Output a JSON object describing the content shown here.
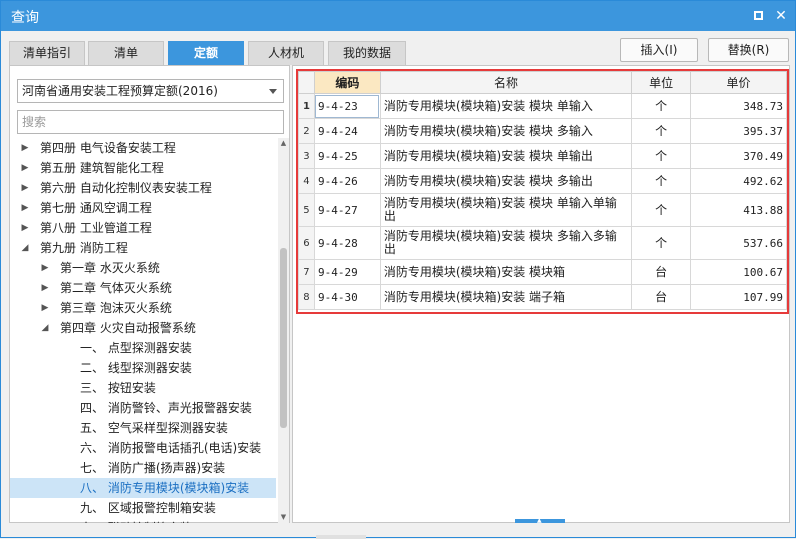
{
  "window": {
    "title": "查询"
  },
  "tabs": [
    {
      "label": "清单指引",
      "active": false
    },
    {
      "label": "清单",
      "active": false
    },
    {
      "label": "定额",
      "active": true
    },
    {
      "label": "人材机",
      "active": false
    },
    {
      "label": "我的数据",
      "active": false
    }
  ],
  "actions": {
    "insert_label": "插入(I)",
    "replace_label": "替换(R)"
  },
  "left": {
    "library_select": "河南省通用安装工程预算定额(2016)",
    "search_placeholder": "搜索",
    "tree": [
      {
        "label": "第四册 电气设备安装工程",
        "level": 0,
        "expand": "collapsed"
      },
      {
        "label": "第五册 建筑智能化工程",
        "level": 0,
        "expand": "collapsed"
      },
      {
        "label": "第六册 自动化控制仪表安装工程",
        "level": 0,
        "expand": "collapsed"
      },
      {
        "label": "第七册 通风空调工程",
        "level": 0,
        "expand": "collapsed"
      },
      {
        "label": "第八册 工业管道工程",
        "level": 0,
        "expand": "collapsed"
      },
      {
        "label": "第九册 消防工程",
        "level": 0,
        "expand": "expanded"
      },
      {
        "label": "第一章 水灭火系统",
        "level": 1,
        "expand": "collapsed"
      },
      {
        "label": "第二章 气体灭火系统",
        "level": 1,
        "expand": "collapsed"
      },
      {
        "label": "第三章 泡沫灭火系统",
        "level": 1,
        "expand": "collapsed"
      },
      {
        "label": "第四章 火灾自动报警系统",
        "level": 1,
        "expand": "expanded"
      },
      {
        "label": "一、 点型探测器安装",
        "level": 2,
        "expand": "none"
      },
      {
        "label": "二、 线型探测器安装",
        "level": 2,
        "expand": "none"
      },
      {
        "label": "三、 按钮安装",
        "level": 2,
        "expand": "none"
      },
      {
        "label": "四、 消防警铃、声光报警器安装",
        "level": 2,
        "expand": "none"
      },
      {
        "label": "五、 空气采样型探测器安装",
        "level": 2,
        "expand": "none"
      },
      {
        "label": "六、 消防报警电话插孔(电话)安装",
        "level": 2,
        "expand": "none"
      },
      {
        "label": "七、 消防广播(扬声器)安装",
        "level": 2,
        "expand": "none"
      },
      {
        "label": "八、 消防专用模块(模块箱)安装",
        "level": 2,
        "expand": "none",
        "selected": true
      },
      {
        "label": "九、 区域报警控制箱安装",
        "level": 2,
        "expand": "none"
      },
      {
        "label": "十、 联动控制箱安装",
        "level": 2,
        "expand": "none"
      }
    ]
  },
  "grid": {
    "columns": [
      "编码",
      "名称",
      "单位",
      "单价"
    ],
    "rows": [
      {
        "no": "1",
        "code": "9-4-23",
        "name": "消防专用模块(模块箱)安装 模块 单输入",
        "unit": "个",
        "price": "348.73"
      },
      {
        "no": "2",
        "code": "9-4-24",
        "name": "消防专用模块(模块箱)安装 模块 多输入",
        "unit": "个",
        "price": "395.37"
      },
      {
        "no": "3",
        "code": "9-4-25",
        "name": "消防专用模块(模块箱)安装 模块 单输出",
        "unit": "个",
        "price": "370.49"
      },
      {
        "no": "4",
        "code": "9-4-26",
        "name": "消防专用模块(模块箱)安装 模块 多输出",
        "unit": "个",
        "price": "492.62"
      },
      {
        "no": "5",
        "code": "9-4-27",
        "name": "消防专用模块(模块箱)安装 模块 单输入单输出",
        "unit": "个",
        "price": "413.88"
      },
      {
        "no": "6",
        "code": "9-4-28",
        "name": "消防专用模块(模块箱)安装 模块 多输入多输出",
        "unit": "个",
        "price": "537.66"
      },
      {
        "no": "7",
        "code": "9-4-29",
        "name": "消防专用模块(模块箱)安装 模块箱",
        "unit": "台",
        "price": "100.67"
      },
      {
        "no": "8",
        "code": "9-4-30",
        "name": "消防专用模块(模块箱)安装 端子箱",
        "unit": "台",
        "price": "107.99"
      }
    ]
  },
  "icons": {
    "restore": "restore-icon",
    "close": "close-icon"
  }
}
